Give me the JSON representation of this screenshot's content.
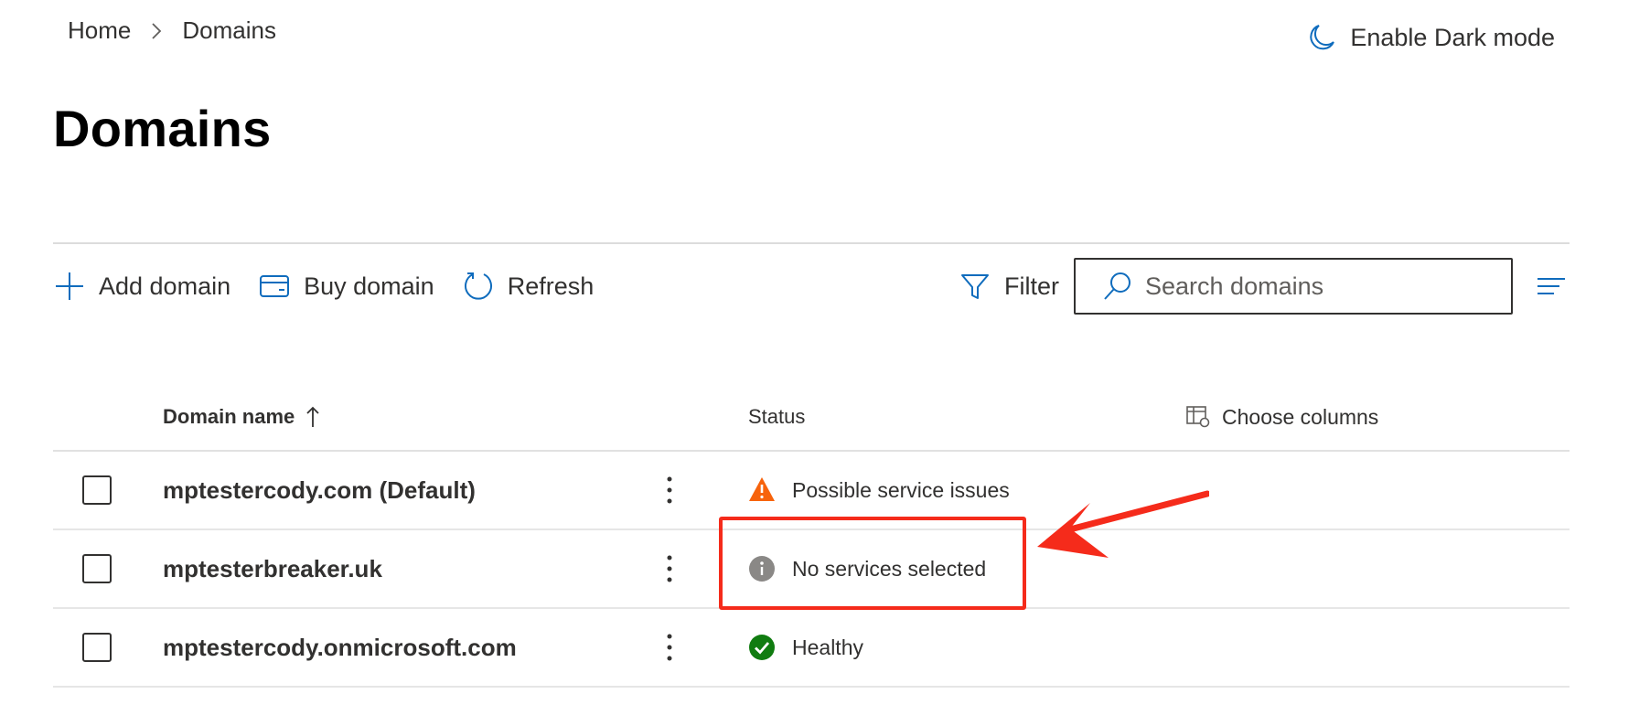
{
  "breadcrumb": {
    "home": "Home",
    "current": "Domains"
  },
  "header": {
    "dark_mode_label": "Enable Dark mode"
  },
  "page": {
    "title": "Domains"
  },
  "toolbar": {
    "add_domain": "Add domain",
    "buy_domain": "Buy domain",
    "refresh": "Refresh",
    "filter": "Filter",
    "search_placeholder": "Search domains"
  },
  "table": {
    "columns": {
      "name": "Domain name",
      "status": "Status",
      "choose_columns": "Choose columns"
    },
    "rows": [
      {
        "name": "mptestercody.com (Default)",
        "status": "Possible service issues",
        "status_type": "warning"
      },
      {
        "name": "mptesterbreaker.uk",
        "status": "No services selected",
        "status_type": "info"
      },
      {
        "name": "mptestercody.onmicrosoft.com",
        "status": "Healthy",
        "status_type": "healthy"
      }
    ]
  },
  "colors": {
    "accent": "#0f6cbd",
    "warning": "#f7630c",
    "info": "#8a8886",
    "healthy": "#107c10",
    "annotation": "#f52b1b"
  }
}
